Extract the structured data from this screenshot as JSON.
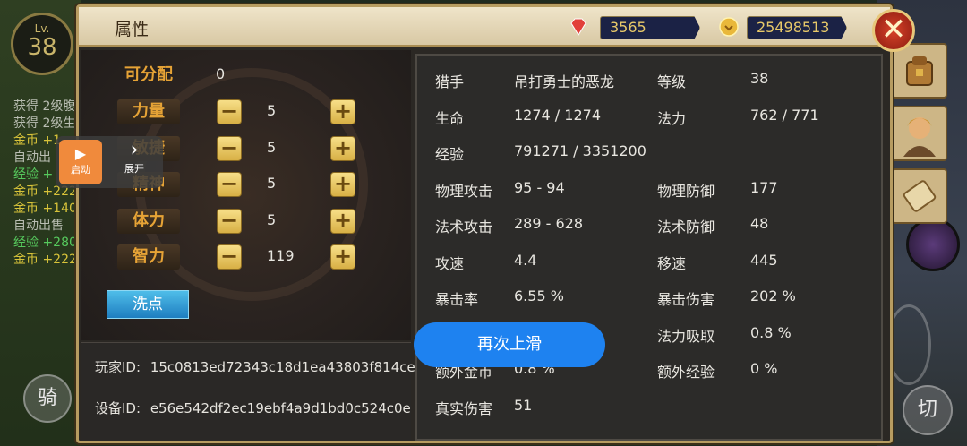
{
  "hud": {
    "level_prefix": "Lv.",
    "level": "38",
    "ride_label": "骑",
    "cut_label": "切",
    "log_lines": [
      {
        "text": "获得 2级腹",
        "color": "gray"
      },
      {
        "text": "获得 2级生",
        "color": "gray"
      },
      {
        "text": "金币 +1",
        "color": "gold"
      },
      {
        "text": "自动出",
        "color": "gray"
      },
      {
        "text": "经验 +",
        "color": "green"
      },
      {
        "text": "金币 +222",
        "color": "gold"
      },
      {
        "text": "金币 +140",
        "color": "gold"
      },
      {
        "text": "自动出售",
        "color": "gray"
      },
      {
        "text": "经验 +280",
        "color": "green"
      },
      {
        "text": "金币 +222",
        "color": "gold"
      }
    ]
  },
  "window": {
    "title": "属性",
    "gems": "3565",
    "gold": "25498513",
    "close_icon": "close-icon"
  },
  "attributes": {
    "available_label": "可分配",
    "available_value": "0",
    "rows": [
      {
        "label": "力量",
        "value": "5"
      },
      {
        "label": "敏捷",
        "value": "5"
      },
      {
        "label": "精神",
        "value": "5"
      },
      {
        "label": "体力",
        "value": "5"
      },
      {
        "label": "智力",
        "value": "119"
      }
    ],
    "minus": "−",
    "plus": "+",
    "reset_label": "洗点"
  },
  "ids": {
    "player_label": "玩家ID:",
    "player_id": "15c0813ed72343c18d1ea43803f814ce",
    "device_label": "设备ID:",
    "device_id": "e56e542df2ec19ebf4a9d1bd0c524c0e"
  },
  "stats": {
    "class_label": "猎手",
    "class_value": "吊打勇士的恶龙",
    "level_label": "等级",
    "level_value": "38",
    "hp_label": "生命",
    "hp_value": "1274 / 1274",
    "mp_label": "法力",
    "mp_value": "762 / 771",
    "exp_label": "经验",
    "exp_value": "791271 / 3351200",
    "patk_label": "物理攻击",
    "patk_value": "95 - 94",
    "pdef_label": "物理防御",
    "pdef_value": "177",
    "matk_label": "法术攻击",
    "matk_value": "289 - 628",
    "mdef_label": "法术防御",
    "mdef_value": "48",
    "aspd_label": "攻速",
    "aspd_value": "4.4",
    "mspd_label": "移速",
    "mspd_value": "445",
    "crit_label": "暴击率",
    "crit_value": "6.55 %",
    "critdmg_label": "暴击伤害",
    "critdmg_value": "202 %",
    "drain_label": "法力吸取",
    "drain_value": "0.8 %",
    "extra_gold_label": "额外金币",
    "extra_gold_value": "0.8 %",
    "extra_exp_label": "额外经验",
    "extra_exp_value": "0 %",
    "true_dmg_label": "真实伤害",
    "true_dmg_value": "51"
  },
  "overlay": {
    "start_label": "启动",
    "expand_label": "展开",
    "swipe_label": "再次上滑"
  }
}
